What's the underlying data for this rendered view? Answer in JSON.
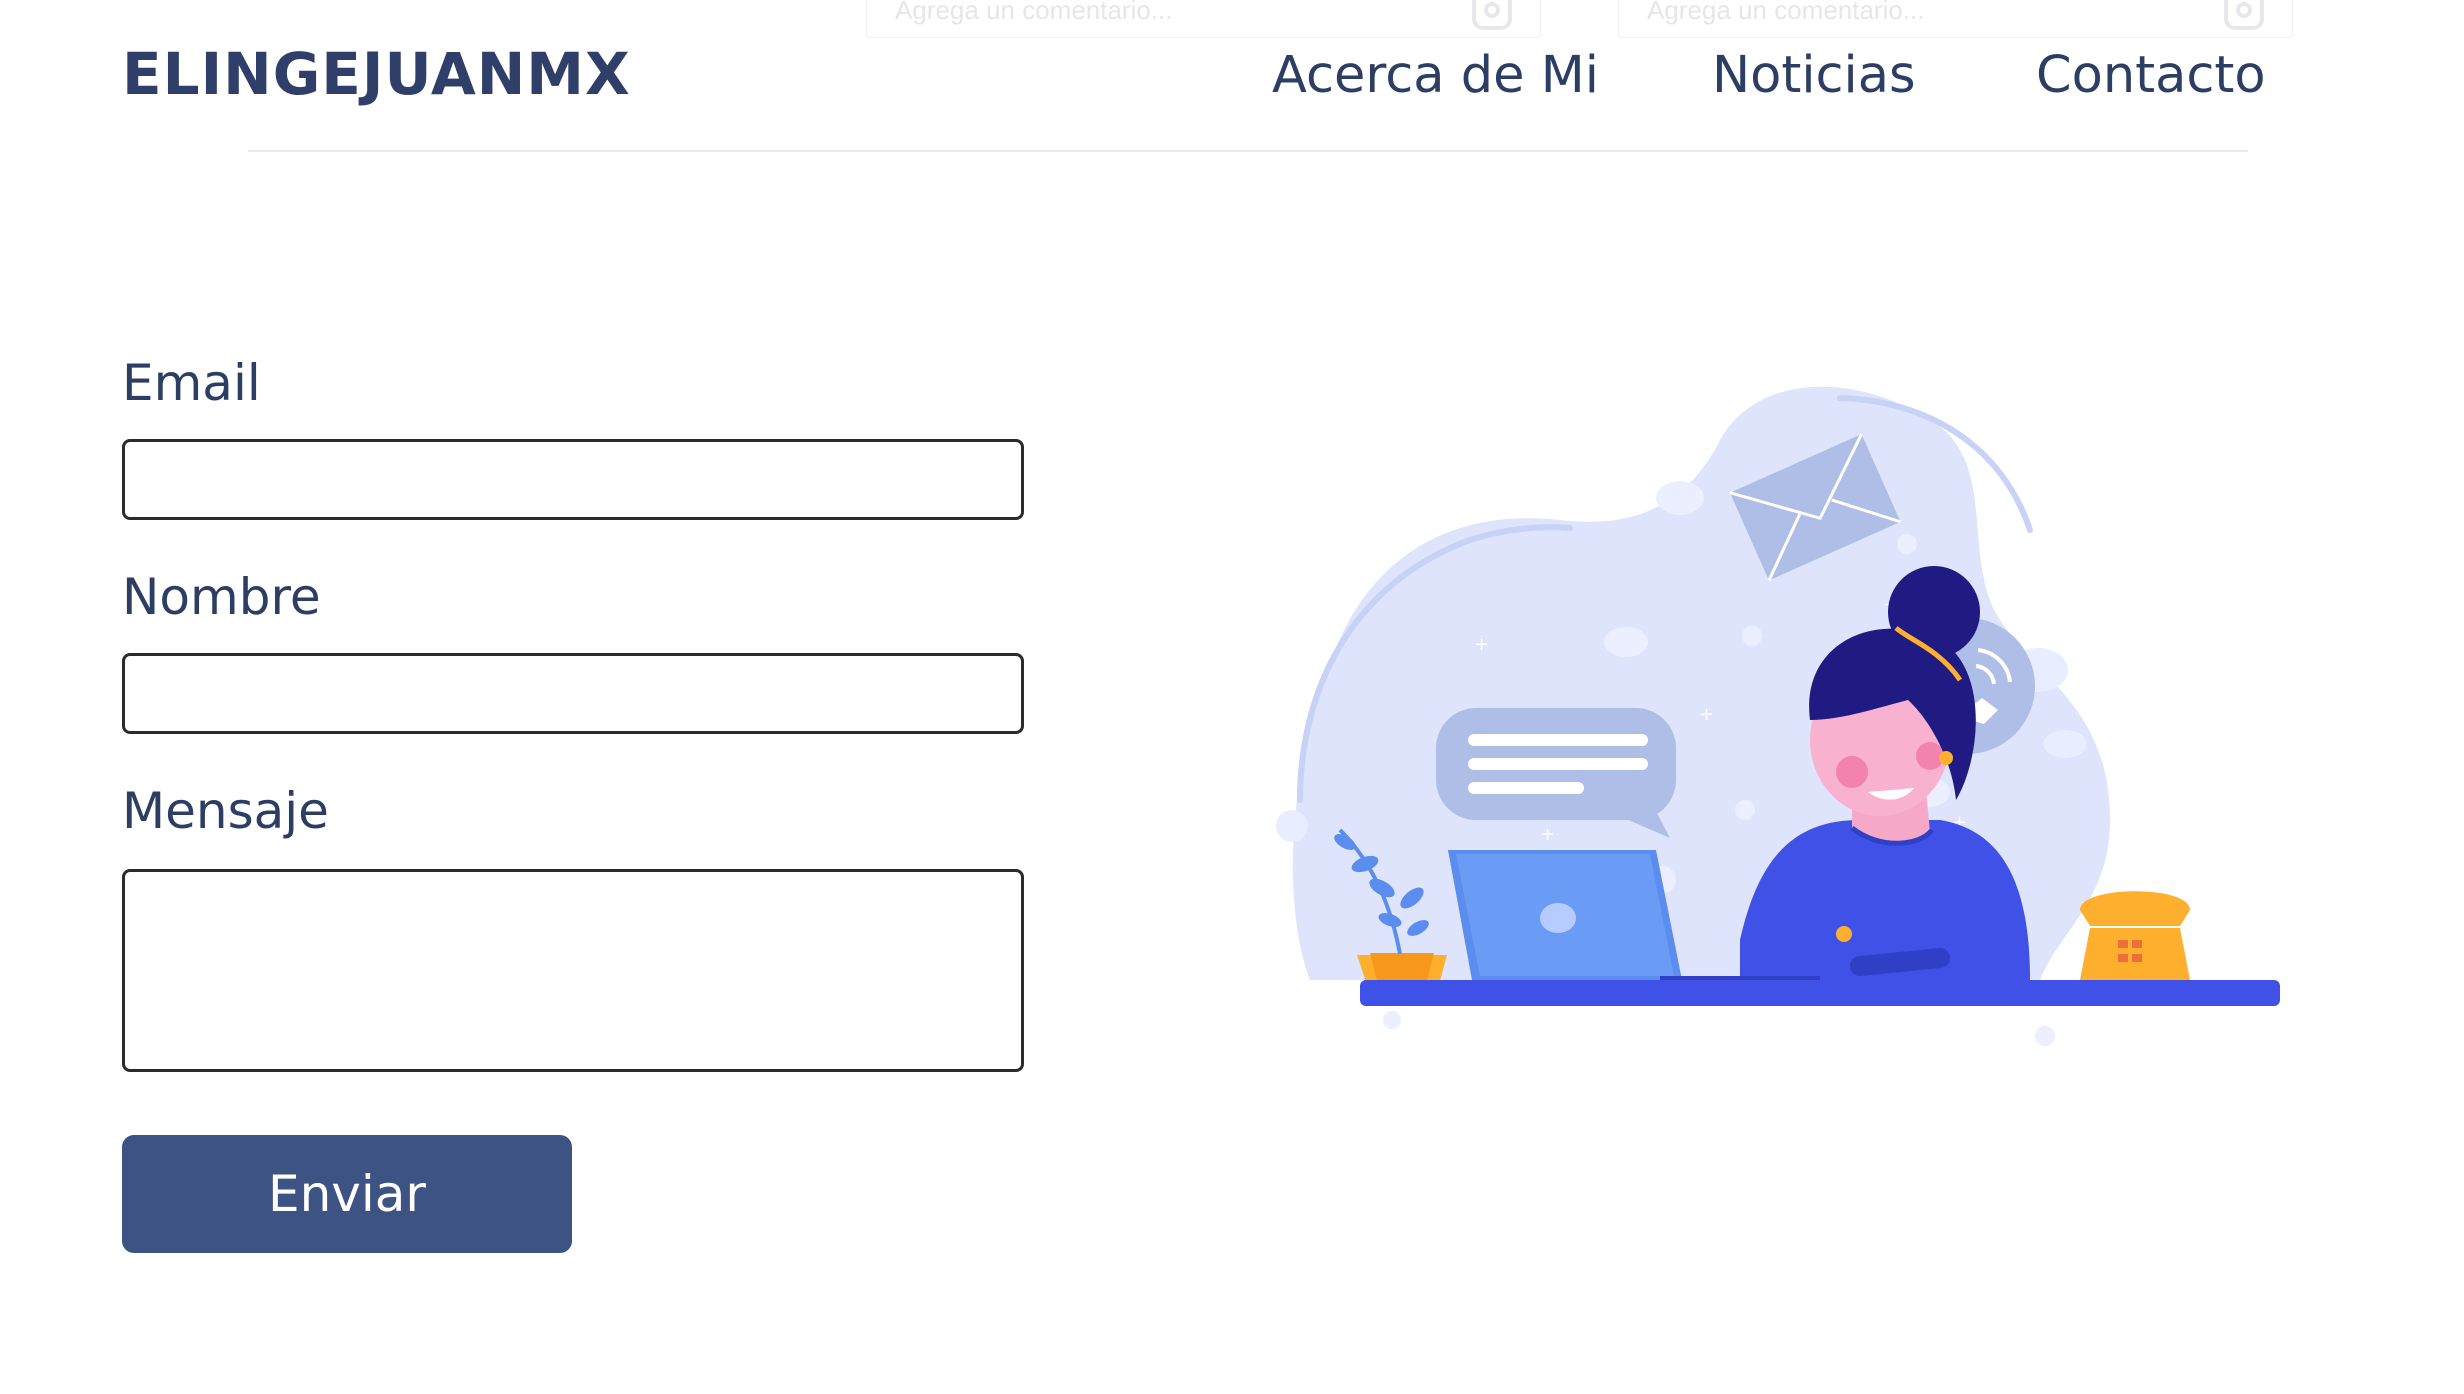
{
  "ghost_comment_bars": [
    {
      "placeholder": "Agrega un comentario...",
      "icon": "instagram-icon"
    },
    {
      "placeholder": "Agrega un comentario...",
      "icon": "instagram-icon"
    }
  ],
  "header": {
    "logo": "ELINGEJUANMX",
    "nav": [
      {
        "label": "Acerca de Mi"
      },
      {
        "label": "Noticias"
      },
      {
        "label": "Contacto"
      }
    ]
  },
  "form": {
    "email_label": "Email",
    "email_value": "",
    "name_label": "Nombre",
    "name_value": "",
    "message_label": "Mensaje",
    "message_value": "",
    "submit_label": "Enviar"
  },
  "illustration": {
    "subject": "woman-working-on-laptop",
    "icons": [
      "envelope-icon",
      "chat-bubble-icon",
      "phone-icon",
      "plant-icon",
      "telephone-icon"
    ]
  },
  "colors": {
    "logo": "#2f3f69",
    "text": "#2c3e63",
    "button": "#3c5383",
    "illustration_blob": "#dde4fb",
    "illustration_accent": "#3f51e6",
    "illustration_orange": "#ffaf2e"
  }
}
